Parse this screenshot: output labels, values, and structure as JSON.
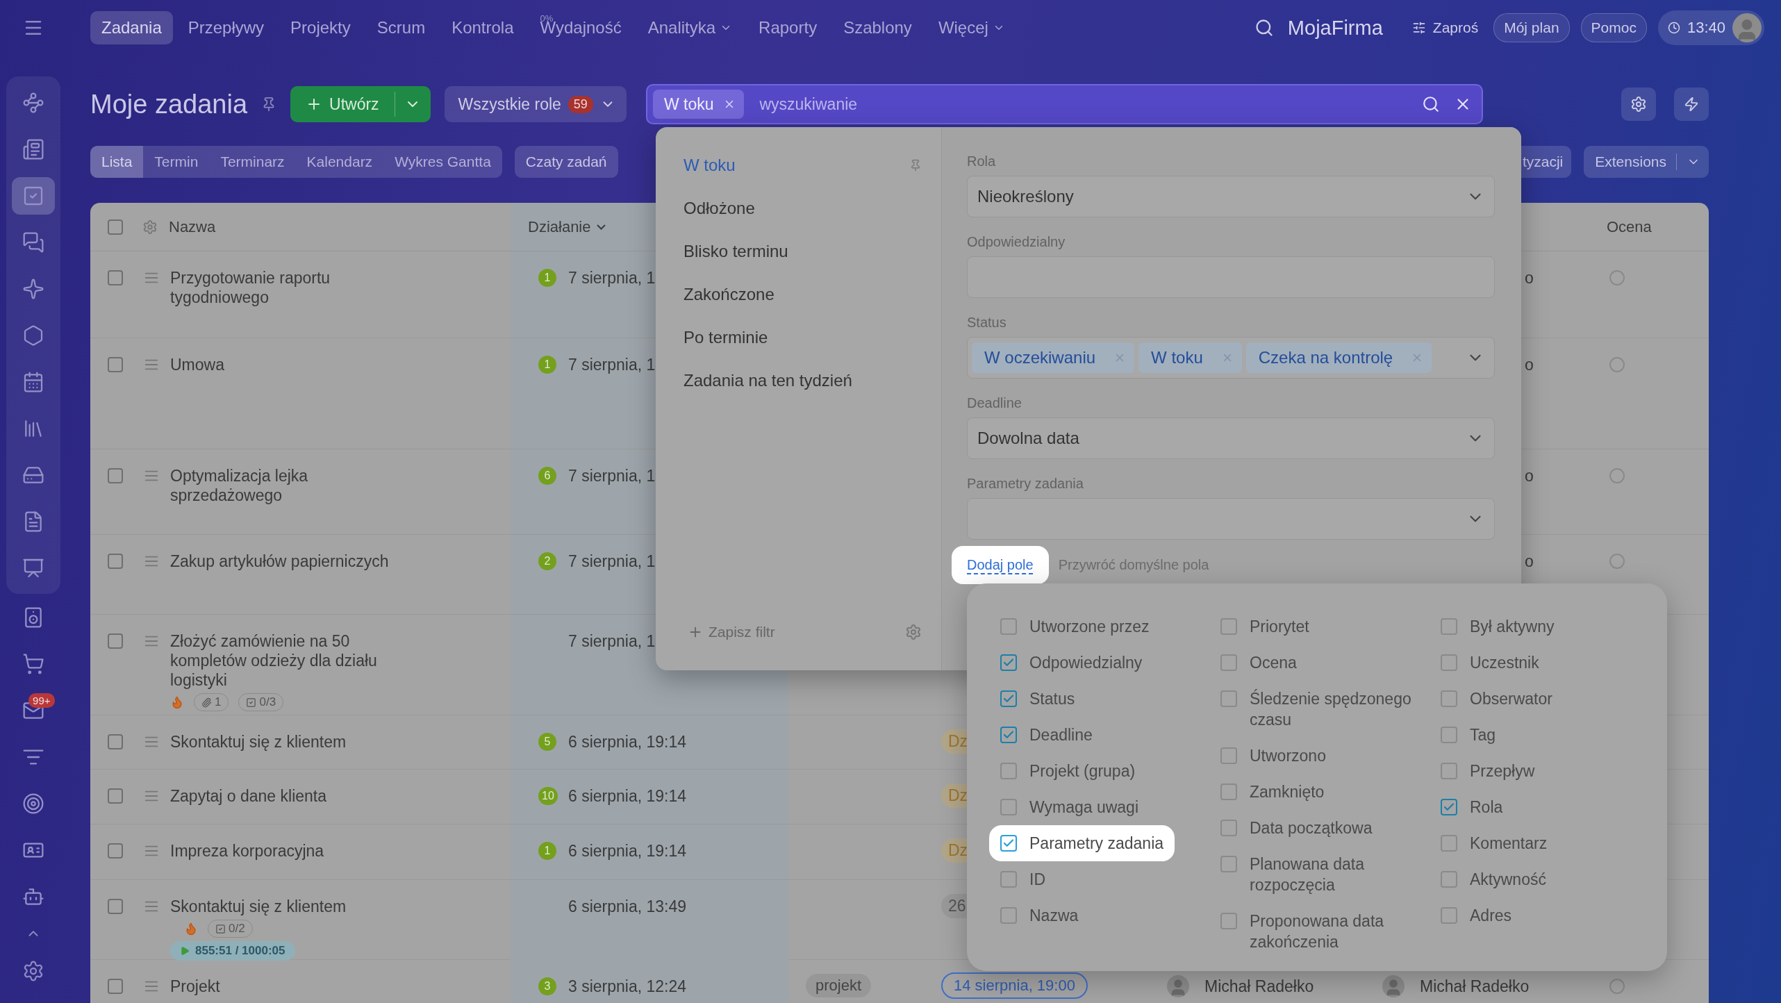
{
  "nav": [
    {
      "label": "Zadania",
      "selected": true,
      "dropdown": false
    },
    {
      "label": "Przepływy",
      "selected": false,
      "dropdown": false
    },
    {
      "label": "Projekty",
      "selected": false,
      "dropdown": false
    },
    {
      "label": "Scrum",
      "selected": false,
      "dropdown": false
    },
    {
      "label": "Kontrola",
      "selected": false,
      "dropdown": false
    },
    {
      "label": "Wydajność",
      "selected": false,
      "dropdown": false,
      "superscript": "0%"
    },
    {
      "label": "Analityka",
      "selected": false,
      "dropdown": true
    },
    {
      "label": "Raporty",
      "selected": false,
      "dropdown": false
    },
    {
      "label": "Szablony",
      "selected": false,
      "dropdown": false
    },
    {
      "label": "Więcej",
      "selected": false,
      "dropdown": true
    }
  ],
  "header_right": {
    "company": "MojaFirma",
    "invite_button": "Zaproś",
    "plan_button": "Mój plan",
    "help_button": "Pomoc",
    "time": "13:40"
  },
  "sidebar": {
    "items": [
      {
        "selected": false
      },
      {
        "selected": false
      },
      {
        "selected": true
      },
      {
        "selected": false
      },
      {
        "selected": false
      },
      {
        "selected": false
      },
      {
        "selected": false
      },
      {
        "selected": false
      },
      {
        "selected": false
      },
      {
        "selected": false
      },
      {
        "selected": false
      },
      {
        "selected": false
      },
      {
        "selected": false
      },
      {
        "selected": false,
        "badge": "99+"
      },
      {
        "selected": false
      },
      {
        "selected": false
      },
      {
        "selected": false
      },
      {
        "selected": false
      }
    ]
  },
  "title": "Moje zadania",
  "create_button": "Utwórz",
  "roles_button": {
    "label": "Wszystkie role",
    "count": "59"
  },
  "search": {
    "chips": [
      {
        "label": "W toku"
      }
    ],
    "placeholder": "wyszukiwanie"
  },
  "view_tabs": [
    {
      "label": "Lista",
      "selected": true
    },
    {
      "label": "Termin",
      "selected": false
    },
    {
      "label": "Terminarz",
      "selected": false
    },
    {
      "label": "Kalendarz",
      "selected": false
    },
    {
      "label": "Wykres Gantta",
      "selected": false
    }
  ],
  "chats_button": "Czaty zadań",
  "partial_button": "tyzacji",
  "extensions_button": "Extensions",
  "table": {
    "select_all_checked": false,
    "columns": [
      {
        "label": "Nazwa",
        "caret": false
      },
      {
        "label": "Działanie",
        "caret": true
      },
      {
        "label": "Ocena",
        "caret": false
      }
    ],
    "rows": [
      {
        "checked": false,
        "name": "Przygotowanie raportu tygodniowego",
        "count": "1",
        "date": "7 sierpnia, 1",
        "urgent": false,
        "column_7": "o",
        "rated": false
      },
      {
        "checked": false,
        "name": "Umowa",
        "count": "1",
        "date": "7 sierpnia, 1",
        "urgent": false,
        "column_7": "o",
        "rated": false
      },
      {
        "checked": false,
        "name": "Optymalizacja lejka sprzedażowego",
        "count": "6",
        "date": "7 sierpnia, 1",
        "urgent": false,
        "column_7": "o",
        "rated": false
      },
      {
        "checked": false,
        "name": "Zakup artykułów papierniczych",
        "count": "2",
        "date": "7 sierpnia, 1",
        "urgent": false,
        "column_7": "o",
        "rated": false
      },
      {
        "checked": false,
        "name": "Złożyć zamówienie na 50 kompletów odzieży dla działu logistyki",
        "date": "7 sierpnia, 1",
        "urgent": true,
        "attachments": "1",
        "checklist": "0/3"
      },
      {
        "checked": false,
        "name": "Skontaktuj się z klientem",
        "count": "5",
        "date": "6 sierpnia, 19:14",
        "urgent": false,
        "status_pill": {
          "text": "Dz",
          "kind": "warning"
        }
      },
      {
        "checked": false,
        "name": "Zapytaj o dane klienta",
        "count": "10",
        "date": "6 sierpnia, 19:14",
        "urgent": false,
        "status_pill": {
          "text": "Dz",
          "kind": "warning"
        }
      },
      {
        "checked": false,
        "name": "Impreza korporacyjna",
        "count": "1",
        "date": "6 sierpnia, 19:14",
        "urgent": false,
        "status_pill": {
          "text": "Dz",
          "kind": "warning"
        }
      },
      {
        "checked": false,
        "name": "Skontaktuj się z klientem",
        "date": "6 sierpnia, 13:49",
        "urgent": true,
        "checklist": "0/2",
        "timer": "855:51 / 1000:05",
        "status_pill": {
          "text": "26",
          "kind": "neutral"
        }
      },
      {
        "checked": false,
        "name": "Projekt",
        "count": "3",
        "date": "3 sierpnia, 12:24",
        "urgent": false,
        "tag": "projekt",
        "deadline": "14 sierpnia, 19:00",
        "people": [
          "Michał Radełko",
          "Michał Radełko"
        ],
        "rated": false
      }
    ]
  },
  "filter": {
    "presets": [
      {
        "label": "W toku",
        "selected": true
      },
      {
        "label": "Odłożone",
        "selected": false
      },
      {
        "label": "Blisko terminu",
        "selected": false
      },
      {
        "label": "Zakończone",
        "selected": false
      },
      {
        "label": "Po terminie",
        "selected": false
      },
      {
        "label": "Zadania na ten tydzień",
        "selected": false
      }
    ],
    "save_filter": "Zapisz filtr",
    "fields": [
      {
        "label": "Rola",
        "kind": "select",
        "value": "Nieokreślony"
      },
      {
        "label": "Odpowiedzialny",
        "kind": "input"
      },
      {
        "label": "Status",
        "kind": "multiselect",
        "chips": [
          "W oczekiwaniu",
          "W toku",
          "Czeka na kontrolę"
        ]
      },
      {
        "label": "Deadline",
        "kind": "select",
        "value": "Dowolna data"
      },
      {
        "label": "Parametry zadania",
        "kind": "select"
      }
    ],
    "add_field": {
      "label": "Dodaj pole",
      "highlighted": true
    },
    "reset_fields": "Przywróć domyślne pola"
  },
  "field_columns": [
    {
      "items": [
        {
          "label": "Utworzone przez",
          "checked": false,
          "highlighted": false
        },
        {
          "label": "Odpowiedzialny",
          "checked": true,
          "highlighted": false
        },
        {
          "label": "Status",
          "checked": true,
          "highlighted": false
        },
        {
          "label": "Deadline",
          "checked": true,
          "highlighted": false
        },
        {
          "label": "Projekt (grupa)",
          "checked": false,
          "highlighted": false
        },
        {
          "label": "Wymaga uwagi",
          "checked": false,
          "highlighted": false
        },
        {
          "label": "Parametry zadania",
          "checked": true,
          "highlighted": true
        },
        {
          "label": "ID",
          "checked": false,
          "highlighted": false
        },
        {
          "label": "Nazwa",
          "checked": false,
          "highlighted": false
        }
      ]
    },
    {
      "items": [
        {
          "label": "Priorytet",
          "checked": false,
          "highlighted": false
        },
        {
          "label": "Ocena",
          "checked": false,
          "highlighted": false
        },
        {
          "label": "Śledzenie spędzonego czasu",
          "checked": false,
          "highlighted": false
        },
        {
          "label": "Utworzono",
          "checked": false,
          "highlighted": false
        },
        {
          "label": "Zamknięto",
          "checked": false,
          "highlighted": false
        },
        {
          "label": "Data początkowa",
          "checked": false,
          "highlighted": false
        },
        {
          "label": "Planowana data rozpoczęcia",
          "checked": false,
          "highlighted": false
        },
        {
          "label": "Proponowana data zakończenia",
          "checked": false,
          "highlighted": false
        }
      ]
    },
    {
      "items": [
        {
          "label": "Był aktywny",
          "checked": false,
          "highlighted": false
        },
        {
          "label": "Uczestnik",
          "checked": false,
          "highlighted": false
        },
        {
          "label": "Obserwator",
          "checked": false,
          "highlighted": false
        },
        {
          "label": "Tag",
          "checked": false,
          "highlighted": false
        },
        {
          "label": "Przepływ",
          "checked": false,
          "highlighted": false
        },
        {
          "label": "Rola",
          "checked": true,
          "highlighted": false
        },
        {
          "label": "Komentarz",
          "checked": false,
          "highlighted": false
        },
        {
          "label": "Aktywność",
          "checked": false,
          "highlighted": false
        },
        {
          "label": "Adres",
          "checked": false,
          "highlighted": false
        }
      ]
    }
  ]
}
